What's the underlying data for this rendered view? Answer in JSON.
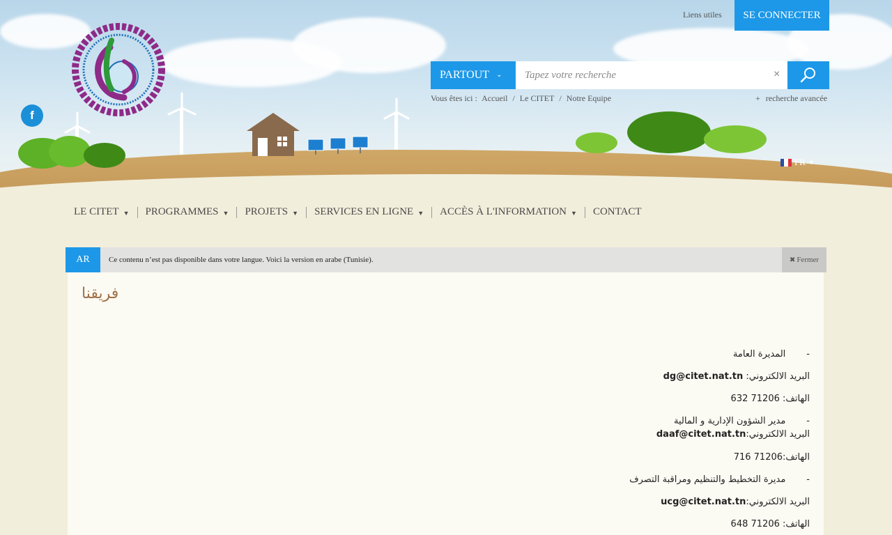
{
  "header": {
    "top_link": "Liens utiles",
    "connect_label": "SE CONNECTER",
    "logo_text": "Centre International des Technologies de l'Environnement de Tunis",
    "social": {
      "facebook_label": "f"
    }
  },
  "search": {
    "scope_label": "PARTOUT",
    "placeholder": "Tapez votre recherche",
    "clear_label": "×",
    "advanced_label": "recherche avancée",
    "advanced_prefix": "+"
  },
  "breadcrumb": {
    "prefix": "Vous êtes ici :",
    "items": [
      "Accueil",
      "/",
      "Le CITET",
      "/",
      "Notre Equipe"
    ]
  },
  "language": {
    "current": "FR"
  },
  "nav": {
    "items": [
      {
        "label": "LE CITET",
        "dropdown": true
      },
      {
        "label": "PROGRAMMES",
        "dropdown": true
      },
      {
        "label": "PROJETS",
        "dropdown": true
      },
      {
        "label": "SERVICES EN LIGNE",
        "dropdown": true
      },
      {
        "label": "ACCÈS À L'INFORMATION",
        "dropdown": true
      },
      {
        "label": "CONTACT",
        "dropdown": false
      }
    ]
  },
  "notice": {
    "lang_label": "AR",
    "text": "Ce contenu n’est pas disponible dans votre langue. Voici la version en arabe (Tunisie).",
    "close_label": "Fermer"
  },
  "content": {
    "title": "فريقنا",
    "lines": {
      "l1_dash": "-",
      "l1_role": "المديرة العامة",
      "l2_label": "البريد الالكتروني:",
      "l2_email": "dg@citet.nat.tn",
      "l3_label": "الهاتف:",
      "l3_phone": "71206 632",
      "l4_dash": "-",
      "l4_role": "مدير الشؤون الإدارية و المالية",
      "l5_label": "البريد الالكتروني:",
      "l5_email": "daaf@citet.nat.tn",
      "l6_label": "الهاتف:",
      "l6_phone": "71206 716",
      "l7_dash": "-",
      "l7_role": "مديرة  التخطيط والتنظيم ومراقبة التصرف",
      "l8_label": "البريد الالكتروني:",
      "l8_email": "ucg@citet.nat.tn",
      "l9_label": "الهاتف:",
      "l9_phone": "71206 648"
    }
  },
  "colors": {
    "accent": "#1d98e8",
    "title": "#a07248",
    "page_bg": "#f2eedc"
  }
}
